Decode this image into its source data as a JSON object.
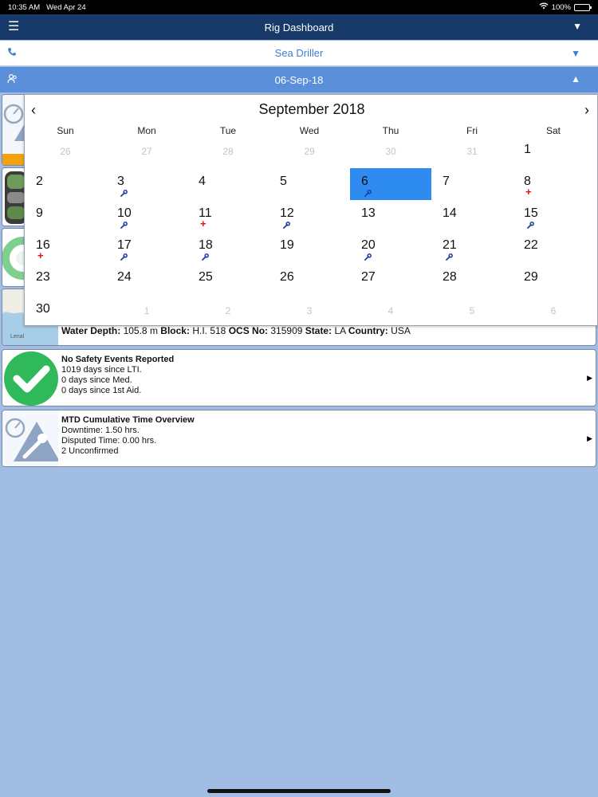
{
  "status_bar": {
    "time": "10:35 AM",
    "date": "Wed Apr 24",
    "battery": "100%"
  },
  "nav": {
    "title": "Rig Dashboard",
    "menu_icon": "hamburger-icon",
    "dropdown_icon": "triangle-down-icon"
  },
  "rig_selector": {
    "name": "Sea Driller"
  },
  "date_selector": {
    "value": "06-Sep-18"
  },
  "calendar": {
    "month_title": "September 2018",
    "prev": "‹",
    "next": "›",
    "weekdays": [
      "Sun",
      "Mon",
      "Tue",
      "Wed",
      "Thu",
      "Fri",
      "Sat"
    ],
    "days": [
      {
        "label": "26",
        "other": true
      },
      {
        "label": "27",
        "other": true
      },
      {
        "label": "28",
        "other": true
      },
      {
        "label": "29",
        "other": true
      },
      {
        "label": "30",
        "other": true
      },
      {
        "label": "31",
        "other": true
      },
      {
        "label": "1"
      },
      {
        "label": "2"
      },
      {
        "label": "3",
        "mark": "wrench"
      },
      {
        "label": "4"
      },
      {
        "label": "5"
      },
      {
        "label": "6",
        "mark": "wrench",
        "selected": true
      },
      {
        "label": "7"
      },
      {
        "label": "8",
        "mark": "plus"
      },
      {
        "label": "9"
      },
      {
        "label": "10",
        "mark": "wrench"
      },
      {
        "label": "11",
        "mark": "plus"
      },
      {
        "label": "12",
        "mark": "wrench"
      },
      {
        "label": "13"
      },
      {
        "label": "14"
      },
      {
        "label": "15",
        "mark": "wrench"
      },
      {
        "label": "16",
        "mark": "plus"
      },
      {
        "label": "17",
        "mark": "wrench"
      },
      {
        "label": "18",
        "mark": "wrench"
      },
      {
        "label": "19"
      },
      {
        "label": "20",
        "mark": "wrench"
      },
      {
        "label": "21",
        "mark": "wrench"
      },
      {
        "label": "22"
      },
      {
        "label": "23"
      },
      {
        "label": "24"
      },
      {
        "label": "25"
      },
      {
        "label": "26"
      },
      {
        "label": "27"
      },
      {
        "label": "28"
      },
      {
        "label": "29"
      },
      {
        "label": "30"
      },
      {
        "label": "1",
        "other": true
      },
      {
        "label": "2",
        "other": true
      },
      {
        "label": "3",
        "other": true
      },
      {
        "label": "4",
        "other": true
      },
      {
        "label": "5",
        "other": true
      },
      {
        "label": "6",
        "other": true
      }
    ]
  },
  "location": {
    "map_label": "Lenal",
    "water_depth_label": "Water Depth:",
    "water_depth_value": "105.8 m",
    "block_label": "Block:",
    "block_value": "H.I. 518",
    "ocs_label": "OCS No:",
    "ocs_value": "315909",
    "state_label": "State:",
    "state_value": "LA",
    "country_label": "Country:",
    "country_value": "USA"
  },
  "safety": {
    "title": "No Safety Events Reported",
    "line1": "1019 days since LTI.",
    "line2": "0 days since Med.",
    "line3": "0 days since 1st Aid."
  },
  "mtd": {
    "title": "MTD Cumulative Time Overview",
    "line1": "Downtime: 1.50 hrs.",
    "line2": "Disputed Time: 0.00 hrs.",
    "line3": "2 Unconfirmed"
  },
  "colors": {
    "nav": "#173a6a",
    "date_bar": "#5b8fd9",
    "accent": "#3f7ed4",
    "selected_day": "#2e8cf0",
    "background": "#a2bde4"
  }
}
